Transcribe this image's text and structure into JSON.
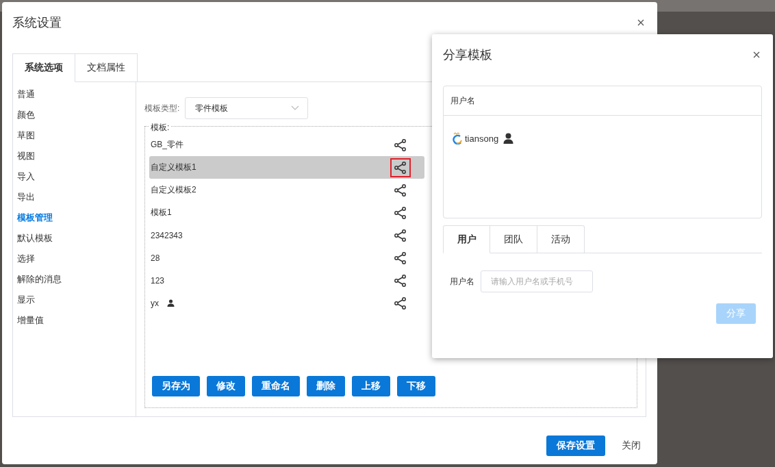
{
  "main_dialog": {
    "title": "系统设置",
    "tabs": [
      {
        "label": "系统选项",
        "selected": true
      },
      {
        "label": "文档属性",
        "selected": false
      }
    ],
    "sidebar": {
      "items": [
        {
          "label": "普通",
          "selected": false
        },
        {
          "label": "颜色",
          "selected": false
        },
        {
          "label": "草图",
          "selected": false
        },
        {
          "label": "视图",
          "selected": false
        },
        {
          "label": "导入",
          "selected": false
        },
        {
          "label": "导出",
          "selected": false
        },
        {
          "label": "模板管理",
          "selected": true
        },
        {
          "label": "默认模板",
          "selected": false
        },
        {
          "label": "选择",
          "selected": false
        },
        {
          "label": "解除的消息",
          "selected": false
        },
        {
          "label": "显示",
          "selected": false
        },
        {
          "label": "增量值",
          "selected": false
        }
      ]
    },
    "template_type": {
      "label": "模板类型:",
      "value": "零件模板"
    },
    "templates": {
      "legend": "模板:",
      "rows": [
        {
          "name": "GB_零件",
          "selected": false,
          "share_focused": false,
          "personal": false
        },
        {
          "name": "自定义模板1",
          "selected": true,
          "share_focused": true,
          "personal": false
        },
        {
          "name": "自定义模板2",
          "selected": false,
          "share_focused": false,
          "personal": false
        },
        {
          "name": "模板1",
          "selected": false,
          "share_focused": false,
          "personal": false
        },
        {
          "name": "2342343",
          "selected": false,
          "share_focused": false,
          "personal": false
        },
        {
          "name": "28",
          "selected": false,
          "share_focused": false,
          "personal": false
        },
        {
          "name": "123",
          "selected": false,
          "share_focused": false,
          "personal": false
        },
        {
          "name": "yx",
          "selected": false,
          "share_focused": false,
          "personal": true
        }
      ]
    },
    "actions": [
      "另存为",
      "修改",
      "重命名",
      "删除",
      "上移",
      "下移"
    ],
    "footer": {
      "save": "保存设置",
      "close": "关闭"
    }
  },
  "share_dialog": {
    "title": "分享模板",
    "users_table": {
      "column": "用户名",
      "rows": [
        {
          "name": "tiansong"
        }
      ]
    },
    "tabs": [
      {
        "label": "用户",
        "selected": true
      },
      {
        "label": "团队",
        "selected": false
      },
      {
        "label": "活动",
        "selected": false
      }
    ],
    "username_field": {
      "label": "用户名",
      "placeholder": "请输入用户名或手机号"
    },
    "share_button": {
      "label": "分享",
      "disabled": true
    }
  }
}
